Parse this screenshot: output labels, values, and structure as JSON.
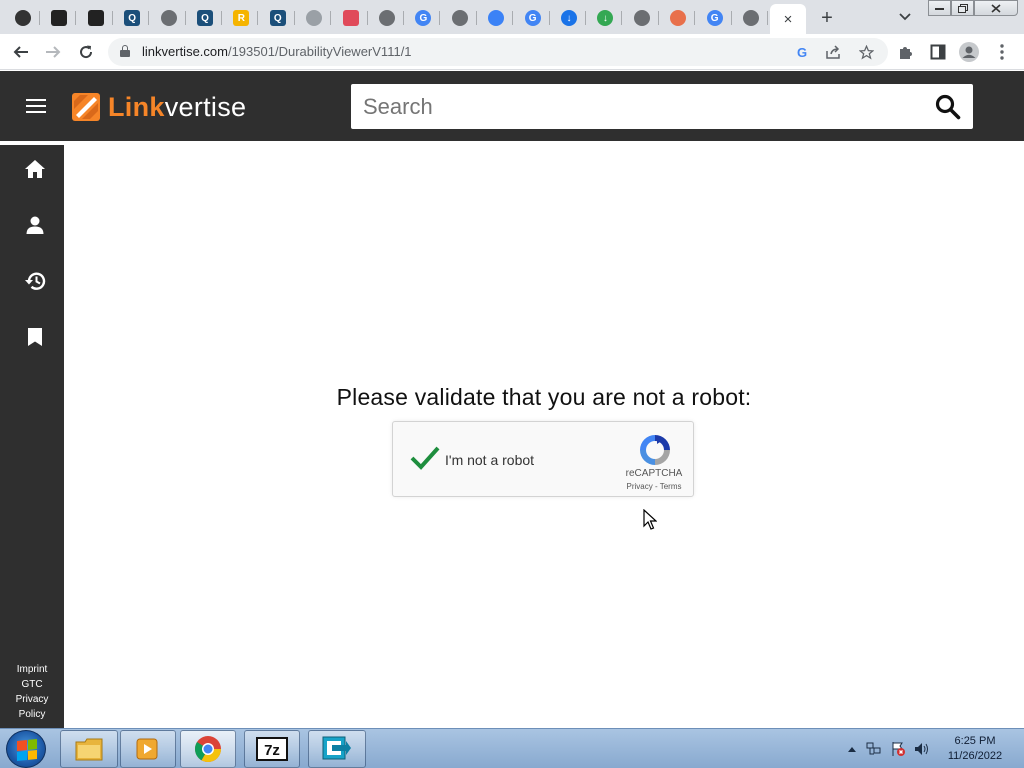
{
  "browser": {
    "url_host": "linkvertise.com",
    "url_path": "/193501/DurabilityViewerV111/1",
    "tab_close_glyph": "×",
    "newtab_glyph": "+",
    "tabs": [
      {
        "icon": "wolf-favicon",
        "color": "#333333",
        "glyph": ""
      },
      {
        "icon": "shield-favicon",
        "color": "#222222",
        "glyph": ""
      },
      {
        "icon": "shield-favicon",
        "color": "#222222",
        "glyph": ""
      },
      {
        "icon": "q-favicon",
        "color": "#1b4f7a",
        "glyph": "Q"
      },
      {
        "icon": "globe-favicon",
        "color": "#6b6e72",
        "glyph": ""
      },
      {
        "icon": "q-favicon",
        "color": "#1b4f7a",
        "glyph": "Q"
      },
      {
        "icon": "rockstar-favicon",
        "color": "#f5b400",
        "glyph": "R"
      },
      {
        "icon": "q-favicon",
        "color": "#1b4f7a",
        "glyph": "Q"
      },
      {
        "icon": "globe-favicon",
        "color": "#9aa0a6",
        "glyph": ""
      },
      {
        "icon": "store-favicon",
        "color": "#e04a5a",
        "glyph": ""
      },
      {
        "icon": "globe-favicon",
        "color": "#6b6e72",
        "glyph": ""
      },
      {
        "icon": "google-favicon",
        "color": "#4285f4",
        "glyph": "G"
      },
      {
        "icon": "globe-favicon",
        "color": "#6b6e72",
        "glyph": ""
      },
      {
        "icon": "hex-favicon",
        "color": "#3b82f6",
        "glyph": ""
      },
      {
        "icon": "google-favicon",
        "color": "#4285f4",
        "glyph": "G"
      },
      {
        "icon": "download-favicon",
        "color": "#1a73e8",
        "glyph": "↓"
      },
      {
        "icon": "download-favicon",
        "color": "#34a853",
        "glyph": "↓"
      },
      {
        "icon": "globe-favicon",
        "color": "#6b6e72",
        "glyph": ""
      },
      {
        "icon": "rainbow-favicon",
        "color": "#e8704b",
        "glyph": ""
      },
      {
        "icon": "google-favicon",
        "color": "#4285f4",
        "glyph": "G"
      },
      {
        "icon": "globe-favicon",
        "color": "#6b6e72",
        "glyph": ""
      }
    ]
  },
  "site": {
    "logo_part1": "Link",
    "logo_part2": "vertise",
    "search_placeholder": "Search",
    "sidebar": [
      "home",
      "profile",
      "history",
      "bookmarks"
    ],
    "footer_links": [
      "Imprint",
      "GTC",
      "Privacy",
      "Policy"
    ]
  },
  "main": {
    "headline": "Please validate that you are not a robot:",
    "captcha_label": "I'm not a robot",
    "captcha_brand": "reCAPTCHA",
    "captcha_links": "Privacy - Terms",
    "captcha_checked": true
  },
  "taskbar": {
    "apps": [
      "explorer",
      "media-player",
      "chrome",
      "7zip",
      "remote-app"
    ],
    "time": "6:25 PM",
    "date": "11/26/2022"
  }
}
